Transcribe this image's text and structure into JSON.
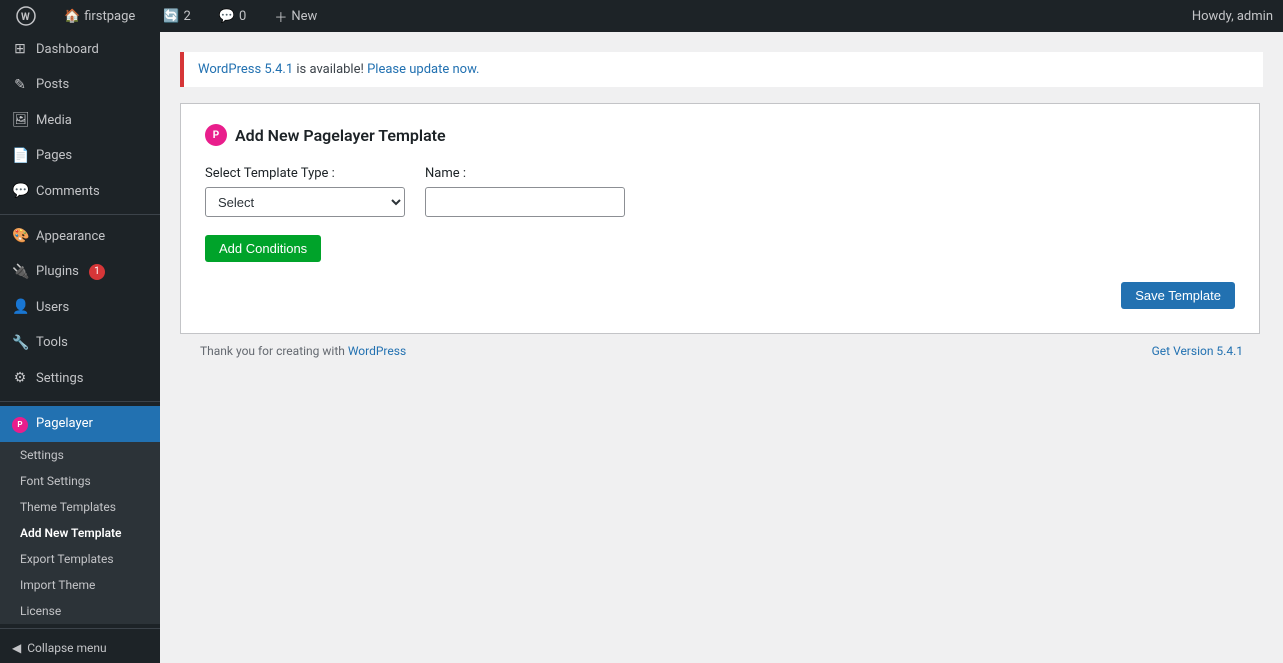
{
  "adminbar": {
    "wp_logo_alt": "WordPress",
    "site_name": "firstpage",
    "updates_count": "2",
    "comments_count": "0",
    "new_label": "New",
    "howdy": "Howdy, admin"
  },
  "sidebar": {
    "menu_items": [
      {
        "id": "dashboard",
        "label": "Dashboard",
        "icon": "⊞"
      },
      {
        "id": "posts",
        "label": "Posts",
        "icon": "✎"
      },
      {
        "id": "media",
        "label": "Media",
        "icon": "🖼"
      },
      {
        "id": "pages",
        "label": "Pages",
        "icon": "📄"
      },
      {
        "id": "comments",
        "label": "Comments",
        "icon": "💬"
      },
      {
        "id": "appearance",
        "label": "Appearance",
        "icon": "🎨"
      },
      {
        "id": "plugins",
        "label": "Plugins",
        "icon": "🔌",
        "badge": "1"
      },
      {
        "id": "users",
        "label": "Users",
        "icon": "👤"
      },
      {
        "id": "tools",
        "label": "Tools",
        "icon": "🔧"
      },
      {
        "id": "settings",
        "label": "Settings",
        "icon": "⚙"
      }
    ],
    "pagelayer_label": "Pagelayer",
    "pagelayer_submenu": [
      {
        "id": "pl-settings",
        "label": "Settings",
        "current": false
      },
      {
        "id": "pl-font-settings",
        "label": "Font Settings",
        "current": false
      },
      {
        "id": "pl-theme-templates",
        "label": "Theme Templates",
        "current": false
      },
      {
        "id": "pl-add-new-template",
        "label": "Add New Template",
        "current": true
      },
      {
        "id": "pl-export-templates",
        "label": "Export Templates",
        "current": false
      },
      {
        "id": "pl-import-theme",
        "label": "Import Theme",
        "current": false
      },
      {
        "id": "pl-license",
        "label": "License",
        "current": false
      }
    ],
    "collapse_label": "Collapse menu"
  },
  "main": {
    "update_notice": {
      "link_text": "WordPress 5.4.1",
      "message": " is available! ",
      "update_link_text": "Please update now."
    },
    "card": {
      "title": "Add New Pagelayer Template",
      "select_template_type_label": "Select Template Type :",
      "select_placeholder": "Select",
      "name_label": "Name :",
      "name_placeholder": "",
      "add_conditions_label": "Add Conditions",
      "save_template_label": "Save Template"
    }
  },
  "footer": {
    "thank_you_text": "Thank you for creating with ",
    "wp_link_text": "WordPress",
    "version_link_text": "Get Version 5.4.1"
  }
}
